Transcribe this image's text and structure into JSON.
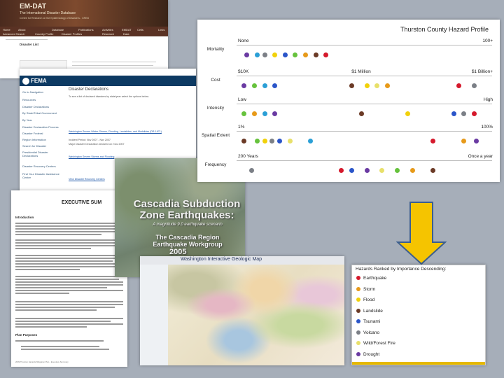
{
  "emdat": {
    "logo": "EM-DAT",
    "tagline": "The International Disaster Database",
    "tagline2": "Centre for Research on the Epidemiology of Disasters - CRED",
    "menu": [
      "Home",
      "About",
      "Database",
      "Publications",
      "Activities",
      "EMDAT",
      "Cells",
      "Links",
      "Advanced Search",
      "Country Profile",
      "Disaster Profiles",
      "Research",
      "Data"
    ],
    "disaster_list_label": "Disaster List"
  },
  "fema": {
    "logo": "FEMA",
    "title": "Disaster Declarations",
    "nav": [
      "Go to Navigation",
      "Resources",
      "Disaster Declarations",
      "By State/Tribal Government",
      "By Year",
      "Disaster Declaration Process",
      "Disaster Federal",
      "Region Information",
      "Search for Disaster",
      "Presidential Disaster Declarations",
      "Disaster Recovery Centers",
      "Find Your Disaster Assistance Center"
    ],
    "intro": "To see a list of declared disasters by state/year select the options below.",
    "link1": "Washington Severe Winter Storms, Flooding, Landslides, and Mudslides (DR-1671)",
    "meta1": "Incident Period: Nov 2007 - Nov 2007",
    "meta2": "Major Disaster Declaration declared on: Nov 2007",
    "link2": "Washington Severe Storms and Flooding",
    "link3": "View Disaster Recovery Centers"
  },
  "doc": {
    "heading": "EXECUTIVE SUM",
    "intro_heading": "Introduction",
    "plan_heading": "Plan Purposes",
    "footer": "2009 Thurston Hazards Mitigation Plan - Executive Summary"
  },
  "cascadia": {
    "title": "Cascadia Subduction Zone Earthquakes:",
    "subtitle": "A magnitude 9.0 earthquake scenario",
    "workgroup": "The Cascadia Region Earthquake Workgroup",
    "year": "2005"
  },
  "geomap": {
    "title": "Washington Interactive Geologic Map"
  },
  "profile": {
    "title": "Thurston County Hazard Profile",
    "rows": [
      {
        "label": "Mortality",
        "left": "None",
        "mid": "",
        "right": "100+",
        "dots": [
          {
            "x": 0.03,
            "color": "#6a3aa2"
          },
          {
            "x": 0.07,
            "color": "#2a9fd6"
          },
          {
            "x": 0.1,
            "color": "#7b7f86"
          },
          {
            "x": 0.14,
            "color": "#f1d10a"
          },
          {
            "x": 0.18,
            "color": "#2a55c9"
          },
          {
            "x": 0.22,
            "color": "#66c23c"
          },
          {
            "x": 0.26,
            "color": "#e79a1a"
          },
          {
            "x": 0.3,
            "color": "#6b3a26"
          },
          {
            "x": 0.34,
            "color": "#d5192c"
          }
        ]
      },
      {
        "label": "Cost",
        "left": "$10K",
        "mid": "$1 Million",
        "right": "$1 Billion+",
        "dots": [
          {
            "x": 0.02,
            "color": "#6a3aa2"
          },
          {
            "x": 0.06,
            "color": "#66c23c"
          },
          {
            "x": 0.1,
            "color": "#2a9fd6"
          },
          {
            "x": 0.14,
            "color": "#2a55c9"
          },
          {
            "x": 0.44,
            "color": "#6b3a26"
          },
          {
            "x": 0.5,
            "color": "#f1d10a"
          },
          {
            "x": 0.54,
            "color": "#e8e06a"
          },
          {
            "x": 0.58,
            "color": "#e79a1a"
          },
          {
            "x": 0.86,
            "color": "#d5192c"
          },
          {
            "x": 0.92,
            "color": "#7b7f86"
          }
        ]
      },
      {
        "label": "Intensity",
        "left": "Low",
        "mid": "",
        "right": "High",
        "dots": [
          {
            "x": 0.02,
            "color": "#66c23c"
          },
          {
            "x": 0.06,
            "color": "#e79a1a"
          },
          {
            "x": 0.1,
            "color": "#2a9fd6"
          },
          {
            "x": 0.14,
            "color": "#6a3aa2"
          },
          {
            "x": 0.48,
            "color": "#6b3a26"
          },
          {
            "x": 0.66,
            "color": "#f1d10a"
          },
          {
            "x": 0.84,
            "color": "#2a55c9"
          },
          {
            "x": 0.88,
            "color": "#7b7f86"
          },
          {
            "x": 0.92,
            "color": "#d5192c"
          }
        ]
      },
      {
        "label": "Spatial Extent",
        "left": "1%",
        "mid": "",
        "right": "100%",
        "dots": [
          {
            "x": 0.02,
            "color": "#6b3a26"
          },
          {
            "x": 0.07,
            "color": "#66c23c"
          },
          {
            "x": 0.1,
            "color": "#f1d10a"
          },
          {
            "x": 0.13,
            "color": "#7b7f86"
          },
          {
            "x": 0.16,
            "color": "#2a55c9"
          },
          {
            "x": 0.2,
            "color": "#e8e06a"
          },
          {
            "x": 0.28,
            "color": "#2a9fd6"
          },
          {
            "x": 0.76,
            "color": "#d5192c"
          },
          {
            "x": 0.88,
            "color": "#e79a1a"
          },
          {
            "x": 0.93,
            "color": "#6a3aa2"
          }
        ]
      },
      {
        "label": "Frequency",
        "left": "200 Years",
        "mid": "",
        "right": "Once a year",
        "dots": [
          {
            "x": 0.05,
            "color": "#7b7f86"
          },
          {
            "x": 0.4,
            "color": "#d5192c"
          },
          {
            "x": 0.44,
            "color": "#2a55c9"
          },
          {
            "x": 0.5,
            "color": "#6a3aa2"
          },
          {
            "x": 0.56,
            "color": "#e8e06a"
          },
          {
            "x": 0.62,
            "color": "#66c23c"
          },
          {
            "x": 0.68,
            "color": "#e79a1a"
          },
          {
            "x": 0.76,
            "color": "#6b3a26"
          }
        ]
      }
    ]
  },
  "ranked": {
    "title": "Hazards Ranked by Importance Descending:",
    "items": [
      {
        "label": "Earthquake",
        "color": "#d5192c"
      },
      {
        "label": "Storm",
        "color": "#e79a1a"
      },
      {
        "label": "Flood",
        "color": "#f1d10a"
      },
      {
        "label": "Landslide",
        "color": "#6b3a26"
      },
      {
        "label": "Tsunami",
        "color": "#2a55c9"
      },
      {
        "label": "Volcano",
        "color": "#7b7f86"
      },
      {
        "label": "Wild/Forest Fire",
        "color": "#e8e06a"
      },
      {
        "label": "Drought",
        "color": "#6a3aa2"
      }
    ]
  },
  "colors": {
    "arrow": "#f5c400",
    "arrow_border": "#3b5e8e",
    "background": "#a6aeb9"
  }
}
